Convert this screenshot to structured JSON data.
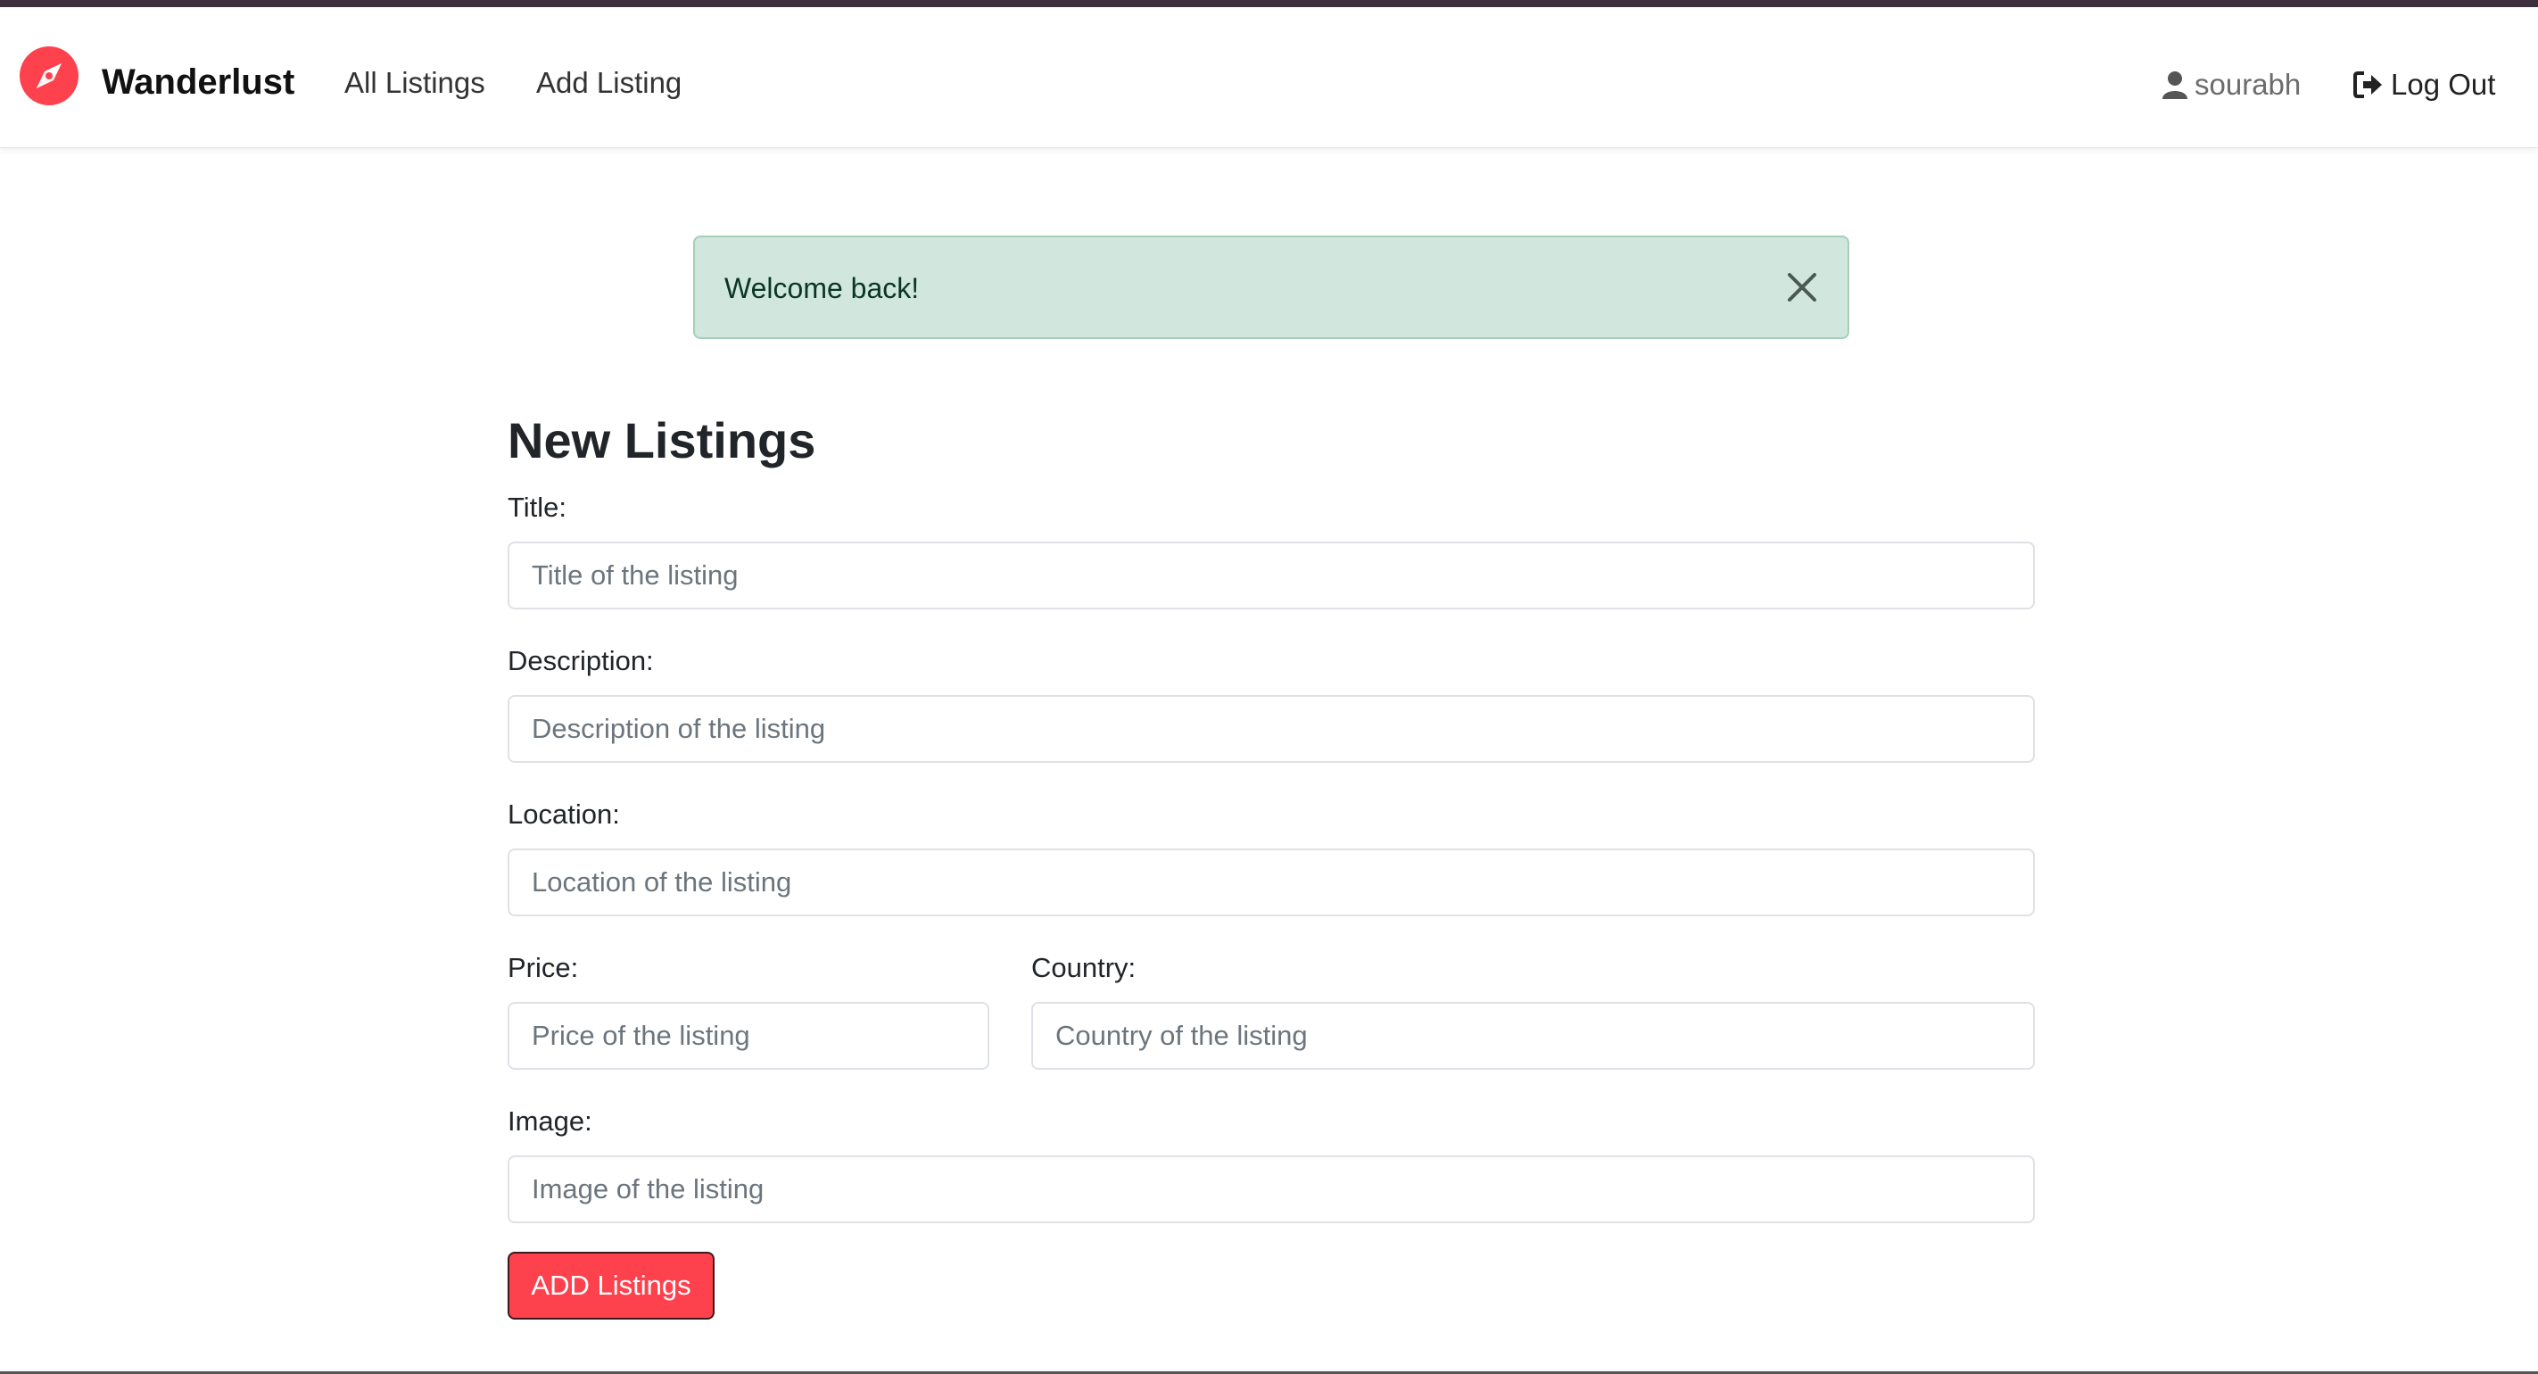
{
  "navbar": {
    "brand_icon": "compass-icon",
    "brand_color": "#fe424d",
    "brand_name": "Wanderlust",
    "links": [
      {
        "label": "All Listings"
      },
      {
        "label": "Add Listing"
      }
    ],
    "user": {
      "icon": "user-icon",
      "name": "sourabh"
    },
    "logout": {
      "icon": "sign-out-icon",
      "label": "Log Out"
    }
  },
  "flash": {
    "message": "Welcome back!",
    "type": "success",
    "close_icon": "close-icon"
  },
  "form": {
    "heading": "New Listings",
    "fields": {
      "title": {
        "label": "Title:",
        "placeholder": "Title of the listing",
        "value": ""
      },
      "description": {
        "label": "Description:",
        "placeholder": "Description of the listing",
        "value": ""
      },
      "location": {
        "label": "Location:",
        "placeholder": "Location of the listing",
        "value": ""
      },
      "price": {
        "label": "Price:",
        "placeholder": "Price of the listing",
        "value": ""
      },
      "country": {
        "label": "Country:",
        "placeholder": "Country of the listing",
        "value": ""
      },
      "image": {
        "label": "Image:",
        "placeholder": "Image of the listing",
        "value": ""
      }
    },
    "submit_label": "ADD Listings",
    "submit_color": "#fe424d"
  }
}
